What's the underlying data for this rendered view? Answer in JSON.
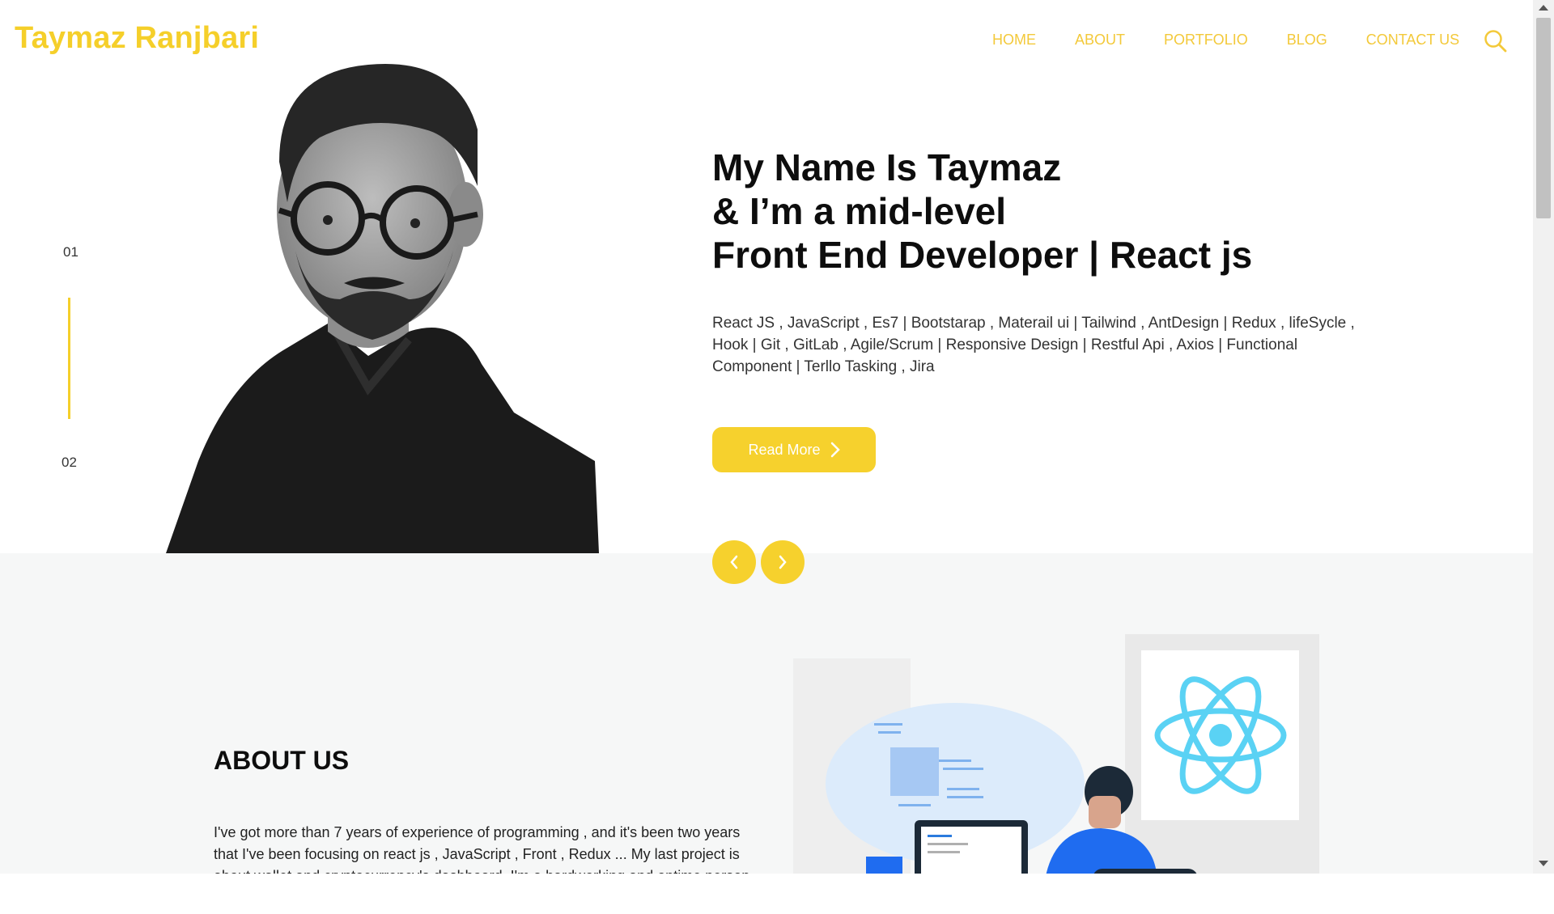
{
  "header": {
    "brand": "Taymaz Ranjbari",
    "nav": [
      "HOME",
      "ABOUT",
      "PORTFOLIO",
      "BLOG",
      "CONTACT US"
    ],
    "search_icon": "search-icon"
  },
  "hero": {
    "slide_numbers": [
      "01",
      "02"
    ],
    "headline_lines": [
      "My Name Is Taymaz",
      "& I’m a mid-level",
      "Front End Developer | React js"
    ],
    "skills": "React JS , JavaScript , Es7 | Bootstarap , Materail ui | Tailwind , AntDesign | Redux , lifeSycle , Hook | Git , GitLab , Agile/Scrum | Responsive Design | Restful Api , Axios | Functional Component | Terllo Tasking , Jira",
    "read_more": "Read More",
    "prev_icon": "chevron-left-icon",
    "next_icon": "chevron-right-icon"
  },
  "about": {
    "title": "ABOUT US",
    "text": "I've got more than 7 years of experience of programming , and it's been two years that I've been focusing on react js , JavaScript , Front , Redux ... My last project is about wallet and cryptocurrency's dashboard. I'm a hardworking and ontime person"
  },
  "colors": {
    "accent": "#f5cf2a",
    "nav_text": "#f3c93a",
    "about_bg": "#f6f7f7",
    "react_blue": "#61dafb"
  }
}
